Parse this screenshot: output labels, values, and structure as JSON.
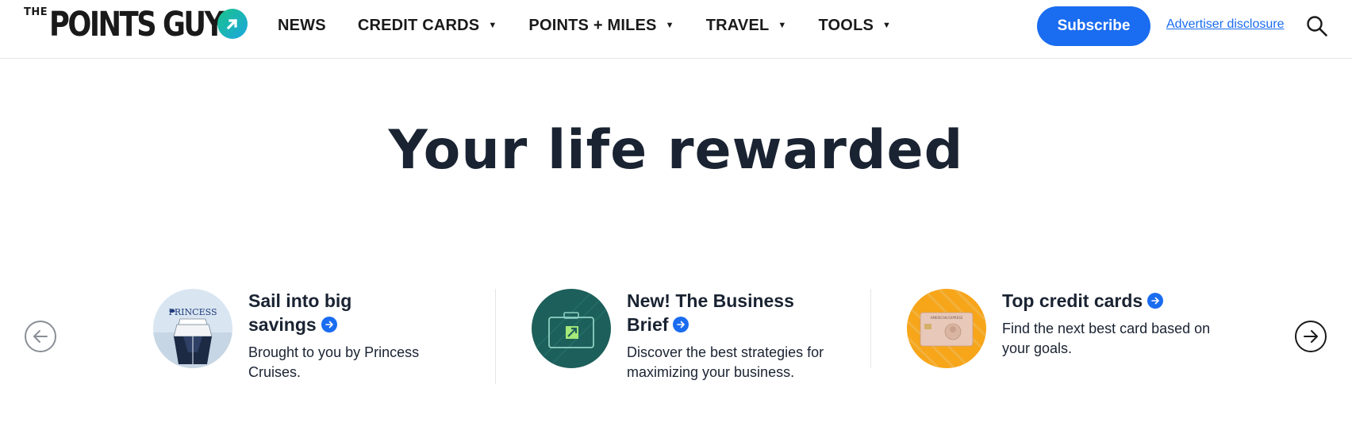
{
  "header": {
    "logo_top": "THE",
    "logo_main": "POINTS GUY",
    "nav": [
      {
        "label": "NEWS",
        "has_dropdown": false
      },
      {
        "label": "CREDIT CARDS",
        "has_dropdown": true
      },
      {
        "label": "POINTS + MILES",
        "has_dropdown": true
      },
      {
        "label": "TRAVEL",
        "has_dropdown": true
      },
      {
        "label": "TOOLS",
        "has_dropdown": true
      }
    ],
    "subscribe_label": "Subscribe",
    "disclosure_label": "Advertiser disclosure",
    "search_icon": "search-icon"
  },
  "hero": {
    "title": "Your life rewarded"
  },
  "carousel": {
    "prev_icon": "arrow-left-icon",
    "next_icon": "arrow-right-icon",
    "cards": [
      {
        "title_line1": "Sail into big",
        "title_line2": "savings",
        "description": "Brought to you by Princess Cruises.",
        "image_brand": "PRINCESS",
        "icon": "cruise-ship-image"
      },
      {
        "title_line1": "New! The Business",
        "title_line2": "Brief",
        "description": "Discover the best strategies for maximizing your business.",
        "icon": "briefcase-icon"
      },
      {
        "title_line1": "Top credit cards",
        "description": "Find the next best card based on your goals.",
        "image_brand": "AMERICAN EXPRESS",
        "icon": "credit-card-image"
      }
    ]
  },
  "colors": {
    "accent": "#1a6cf0",
    "text": "#1a2332",
    "card2_bg": "#1d5f5a",
    "card3_bg": "#f7a519"
  }
}
